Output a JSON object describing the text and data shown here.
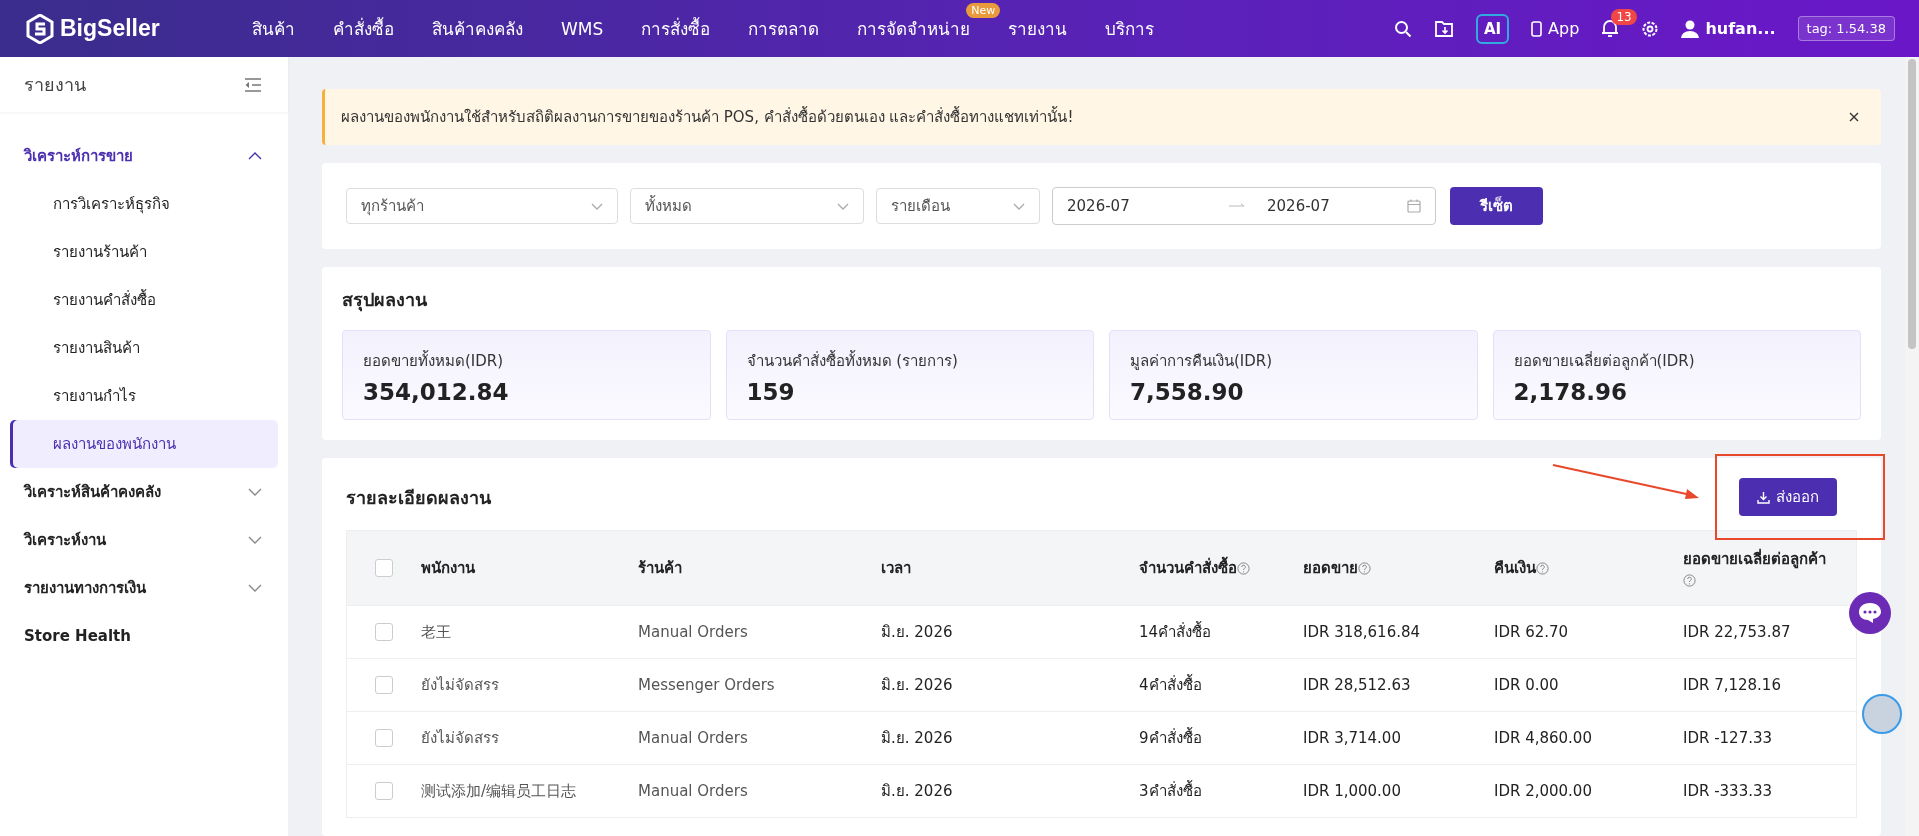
{
  "top_bar": {
    "logo": "BigSeller",
    "nav": [
      {
        "label": "สินค้า"
      },
      {
        "label": "คำสั่งซื้อ"
      },
      {
        "label": "สินค้าคงคลัง"
      },
      {
        "label": "WMS"
      },
      {
        "label": "การสั่งซื้อ"
      },
      {
        "label": "การตลาด"
      },
      {
        "label": "การจัดจำหน่าย",
        "badge": "New"
      },
      {
        "label": "รายงาน"
      },
      {
        "label": "บริการ"
      }
    ],
    "ai_label": "AI",
    "app_label": "App",
    "notification_count": "13",
    "user_name": "hufan...",
    "version_tag": "tag: 1.54.38"
  },
  "sidebar": {
    "title": "รายงาน",
    "groups": [
      {
        "label": "วิเคราะห์การขาย",
        "expanded": true,
        "children": [
          {
            "label": "การวิเคราะห์ธุรกิจ",
            "selected": false
          },
          {
            "label": "รายงานร้านค้า",
            "selected": false
          },
          {
            "label": "รายงานคำสั่งซื้อ",
            "selected": false
          },
          {
            "label": "รายงานสินค้า",
            "selected": false
          },
          {
            "label": "รายงานกำไร",
            "selected": false
          },
          {
            "label": "ผลงานของพนักงาน",
            "selected": true
          }
        ]
      },
      {
        "label": "วิเคราะห์สินค้าคงคลัง",
        "expanded": false
      },
      {
        "label": "วิเคราะห์งาน",
        "expanded": false
      },
      {
        "label": "รายงานทางการเงิน",
        "expanded": false
      },
      {
        "label": "Store Health",
        "kind": "link"
      }
    ]
  },
  "alert": {
    "text": "ผลงานของพนักงานใช้สำหรับสถิติผลงานการขายของร้านค้า POS, คำสั่งซื้อด้วยตนเอง และคำสั่งซื้อทางแชทเท่านั้น!"
  },
  "filters": {
    "selects": [
      {
        "value": "ทุกร้านค้า"
      },
      {
        "value": "ทั้งหมด"
      },
      {
        "value": "รายเดือน"
      }
    ],
    "date_start": "2026-07",
    "date_end": "2026-07",
    "reset_button": "รีเซ็ต"
  },
  "summary": {
    "title": "สรุปผลงาน",
    "cards": [
      {
        "label": "ยอดขายทั้งหมด(IDR)",
        "value": "354,012.84"
      },
      {
        "label": "จำนวนคำสั่งซื้อทั้งหมด (รายการ)",
        "value": "159"
      },
      {
        "label": "มูลค่าการคืนเงิน(IDR)",
        "value": "7,558.90"
      },
      {
        "label": "ยอดขายเฉลี่ยต่อลูกค้า(IDR)",
        "value": "2,178.96"
      }
    ]
  },
  "details": {
    "title": "รายละเอียดผลงาน",
    "export_button": "ส่งออก",
    "select_all_checked": false,
    "columns": [
      {
        "label": "พนักงาน",
        "help": false
      },
      {
        "label": "ร้านค้า",
        "help": false
      },
      {
        "label": "เวลา",
        "help": false
      },
      {
        "label": "จำนวนคำสั่งซื้อ",
        "help": true
      },
      {
        "label": "ยอดขาย",
        "help": true
      },
      {
        "label": "คืนเงิน",
        "help": true
      },
      {
        "label": "ยอดขายเฉลี่ยต่อลูกค้า",
        "help": true
      }
    ],
    "rows": [
      {
        "checked": false,
        "cells": [
          "老王",
          "Manual Orders",
          "มิ.ย. 2026",
          "14คำสั่งซื้อ",
          "IDR 318,616.84",
          "IDR 62.70",
          "IDR 22,753.87"
        ]
      },
      {
        "checked": false,
        "cells": [
          "ยังไม่จัดสรร",
          "Messenger Orders",
          "มิ.ย. 2026",
          "4คำสั่งซื้อ",
          "IDR 28,512.63",
          "IDR 0.00",
          "IDR 7,128.16"
        ]
      },
      {
        "checked": false,
        "cells": [
          "ยังไม่จัดสรร",
          "Manual Orders",
          "มิ.ย. 2026",
          "9คำสั่งซื้อ",
          "IDR 3,714.00",
          "IDR 4,860.00",
          "IDR -127.33"
        ]
      },
      {
        "checked": false,
        "cells": [
          "测试添加/编辑员工日志",
          "Manual Orders",
          "มิ.ย. 2026",
          "3คำสั่งซื้อ",
          "IDR 1,000.00",
          "IDR 2,000.00",
          "IDR -333.33"
        ]
      }
    ]
  }
}
